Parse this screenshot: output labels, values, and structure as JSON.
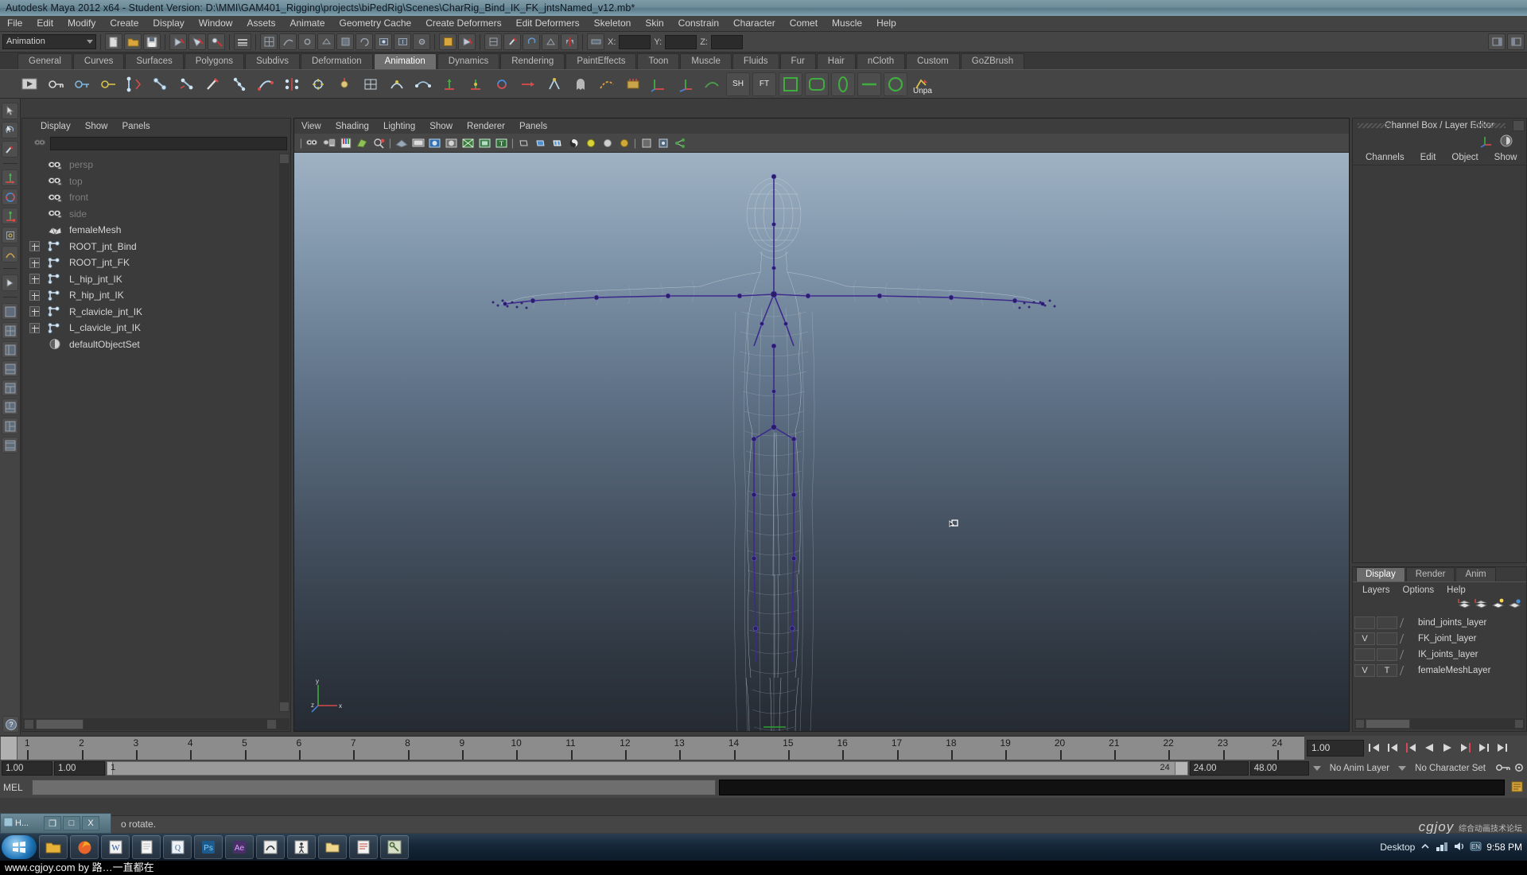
{
  "window": {
    "title": "Autodesk Maya 2012 x64 - Student Version: D:\\MMI\\GAM401_Rigging\\projects\\biPedRig\\Scenes\\CharRig_Bind_IK_FK_jntsNamed_v12.mb*"
  },
  "menubar": {
    "items": [
      "File",
      "Edit",
      "Modify",
      "Create",
      "Display",
      "Window",
      "Assets",
      "Animate",
      "Geometry Cache",
      "Create Deformers",
      "Edit Deformers",
      "Skeleton",
      "Skin",
      "Constrain",
      "Character",
      "Comet",
      "Muscle",
      "Help"
    ]
  },
  "status_bar": {
    "mode": "Animation",
    "x_label": "X:",
    "y_label": "Y:",
    "z_label": "Z:",
    "x_value": "",
    "y_value": "",
    "z_value": ""
  },
  "shelf": {
    "tabs": [
      "General",
      "Curves",
      "Surfaces",
      "Polygons",
      "Subdivs",
      "Deformation",
      "Animation",
      "Dynamics",
      "Rendering",
      "PaintEffects",
      "Toon",
      "Muscle",
      "Fluids",
      "Fur",
      "Hair",
      "nCloth",
      "Custom",
      "GoZBrush"
    ],
    "active_tab": "Animation",
    "button_labels": [
      "SH",
      "FT",
      "Unpa"
    ]
  },
  "outliner": {
    "menu": [
      "Display",
      "Show",
      "Panels"
    ],
    "search_value": "",
    "items": [
      {
        "name": "persp",
        "icon": "camera-icon",
        "expandable": false,
        "dim": true
      },
      {
        "name": "top",
        "icon": "camera-icon",
        "expandable": false,
        "dim": true
      },
      {
        "name": "front",
        "icon": "camera-icon",
        "expandable": false,
        "dim": true
      },
      {
        "name": "side",
        "icon": "camera-icon",
        "expandable": false,
        "dim": true
      },
      {
        "name": "femaleMesh",
        "icon": "mesh-icon",
        "expandable": false,
        "dim": false
      },
      {
        "name": "ROOT_jnt_Bind",
        "icon": "joint-icon",
        "expandable": true,
        "dim": false
      },
      {
        "name": "ROOT_jnt_FK",
        "icon": "joint-icon",
        "expandable": true,
        "dim": false
      },
      {
        "name": "L_hip_jnt_IK",
        "icon": "joint-icon",
        "expandable": true,
        "dim": false
      },
      {
        "name": "R_hip_jnt_IK",
        "icon": "joint-icon",
        "expandable": true,
        "dim": false
      },
      {
        "name": "R_clavicle_jnt_IK",
        "icon": "joint-icon",
        "expandable": true,
        "dim": false
      },
      {
        "name": "L_clavicle_jnt_IK",
        "icon": "joint-icon",
        "expandable": true,
        "dim": false
      },
      {
        "name": "defaultObjectSet",
        "icon": "set-icon",
        "expandable": false,
        "dim": false
      }
    ]
  },
  "viewport": {
    "menu": [
      "View",
      "Shading",
      "Lighting",
      "Show",
      "Renderer",
      "Panels"
    ],
    "axis_labels": {
      "x": "x",
      "y": "y",
      "z": "z"
    }
  },
  "channel_box": {
    "title": "Channel Box / Layer Editor",
    "menu": [
      "Channels",
      "Edit",
      "Object",
      "Show"
    ]
  },
  "layer_editor": {
    "tabs": [
      "Display",
      "Render",
      "Anim"
    ],
    "active_tab": "Display",
    "menu": [
      "Layers",
      "Options",
      "Help"
    ],
    "layers": [
      {
        "visibility": "",
        "type": "",
        "name": "bind_joints_layer"
      },
      {
        "visibility": "V",
        "type": "",
        "name": "FK_joint_layer"
      },
      {
        "visibility": "",
        "type": "",
        "name": "IK_joints_layer"
      },
      {
        "visibility": "V",
        "type": "T",
        "name": "femaleMeshLayer"
      }
    ]
  },
  "timeline": {
    "ticks": [
      1,
      2,
      3,
      4,
      5,
      6,
      7,
      8,
      9,
      10,
      11,
      12,
      13,
      14,
      15,
      16,
      17,
      18,
      19,
      20,
      21,
      22,
      23,
      24
    ],
    "current_frame": "1.00"
  },
  "range_slider": {
    "anim_start": "1.00",
    "anim_end": "1.00",
    "range_start": "1",
    "range_end": "24",
    "playback_start": "24.00",
    "playback_end": "48.00",
    "anim_layer": "No Anim Layer",
    "character_set": "No Character Set"
  },
  "command_line": {
    "label": "MEL",
    "input_value": "",
    "output_value": ""
  },
  "help_line": {
    "text": "o rotate."
  },
  "minimized_window": {
    "title": "H...",
    "buttons": [
      "❐",
      "□",
      "X"
    ]
  },
  "taskbar": {
    "icons": [
      "explorer-icon",
      "firefox-icon",
      "word-icon",
      "notepad-icon",
      "quicktime-icon",
      "photoshop-icon",
      "aftereffects-icon",
      "maya-icon",
      "motionbuilder-icon",
      "folder-icon",
      "reader-icon",
      "tool-icon"
    ],
    "desktop_label": "Desktop",
    "time": "9:58 PM"
  },
  "watermark": {
    "text": "www.cgjoy.com by 路…一直都在",
    "logo": "cgjoy",
    "logo_sub": "综合动画技术论坛"
  },
  "colors": {
    "accent_blue": "#7f9ba8",
    "panel_bg": "#3b3b3b",
    "chrome_bg": "#454545",
    "joint_purple": "#3a2a7a",
    "active_tab": "#6e6e6e"
  }
}
